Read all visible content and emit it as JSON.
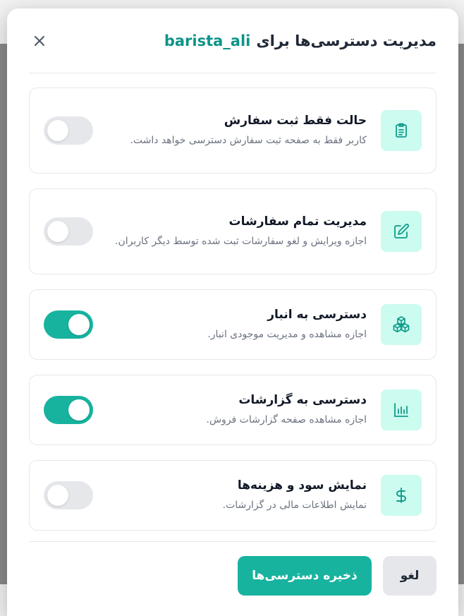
{
  "modal": {
    "title_prefix": "مدیریت دسترسی‌ها برای",
    "username": "barista_ali",
    "close_icon": "close-icon"
  },
  "permissions": [
    {
      "icon": "clipboard-list-icon",
      "title": "حالت فقط ثبت سفارش",
      "description": "کاربر فقط به صفحه ثبت سفارش دسترسی خواهد داشت.",
      "enabled": false
    },
    {
      "icon": "edit-icon",
      "title": "مدیریت تمام سفارشات",
      "description": "اجازه ویرایش و لغو سفارشات ثبت شده توسط دیگر کاربران.",
      "enabled": false
    },
    {
      "icon": "boxes-icon",
      "title": "دسترسی به انبار",
      "description": "اجازه مشاهده و مدیریت موجودی انبار.",
      "enabled": true
    },
    {
      "icon": "bar-chart-icon",
      "title": "دسترسی به گزارشات",
      "description": "اجازه مشاهده صفحه گزارشات فروش.",
      "enabled": true
    },
    {
      "icon": "dollar-icon",
      "title": "نمایش سود و هزینه‌ها",
      "description": "نمایش اطلاعات مالی در گزارشات.",
      "enabled": false
    }
  ],
  "footer": {
    "cancel_label": "لغو",
    "save_label": "ذخیره دسترسی‌ها"
  },
  "colors": {
    "accent": "#17b39f",
    "icon_bg": "#ccfbef",
    "toggle_off": "#e5e7eb"
  }
}
